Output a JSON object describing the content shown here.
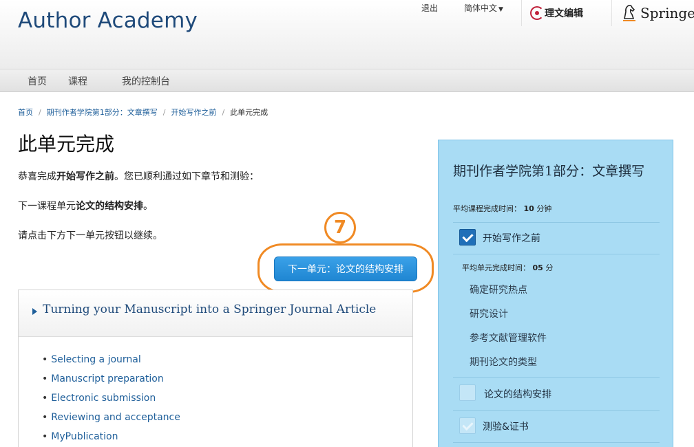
{
  "header": {
    "brand": "Author Academy",
    "logout": "退出",
    "language": "简体中文",
    "partner_logo_text": "理文编辑",
    "springer_logo_text": "Springer"
  },
  "nav": {
    "items": [
      "首页",
      "课程",
      "我的控制台"
    ]
  },
  "breadcrumb": {
    "items": [
      "首页",
      "期刊作者学院第1部分：文章撰写",
      "开始写作之前"
    ],
    "current": "此单元完成",
    "separator": "/"
  },
  "main": {
    "title": "此单元完成",
    "congrats_prefix": "恭喜完成",
    "congrats_unit": "开始写作之前",
    "congrats_suffix": "。您已顺利通过如下章节和测验：",
    "next_prefix": "下一课程单元",
    "next_unit": "论文的结构安排",
    "next_suffix": "。",
    "instruction": "请点击下方下一单元按钮以继续。",
    "next_button": "下一单元：论文的结构安排",
    "annotation_number": "7"
  },
  "course": {
    "title": "Turning your Manuscript into a Springer Journal Article",
    "topics": [
      "Selecting a journal",
      "Manuscript preparation",
      "Electronic submission",
      "Reviewing and acceptance",
      "MyPublication"
    ]
  },
  "sidebar": {
    "title": "期刊作者学院第1部分：文章撰写",
    "avg_label": "平均课程完成时间：",
    "avg_value": "10",
    "avg_unit": "分钟",
    "units": [
      {
        "label": "开始写作之前",
        "state": "checked"
      },
      {
        "label": "论文的结构安排",
        "state": "unchecked"
      },
      {
        "label": "测验&证书",
        "state": "disabled"
      }
    ],
    "unit_avg_label": "平均单元完成时间：",
    "unit_avg_value": "05",
    "unit_avg_unit": "分",
    "subitems": [
      "确定研究热点",
      "研究设计",
      "参考文献管理软件",
      "期刊论文的类型"
    ]
  },
  "colors": {
    "brand": "#1f4a7a",
    "button": "#2a93dd",
    "annotation": "#f08a24",
    "sidebar_bg": "#a9dcf4"
  }
}
